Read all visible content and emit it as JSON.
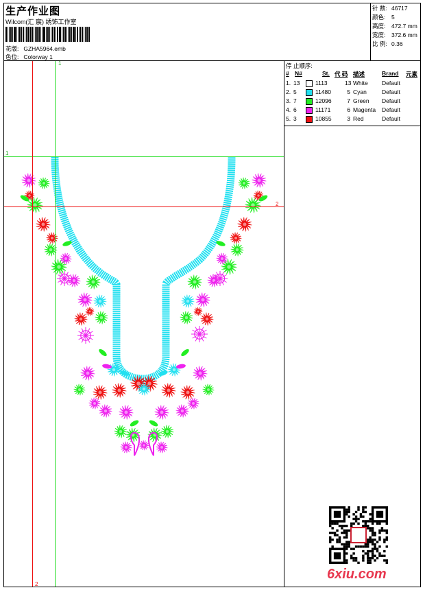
{
  "header": {
    "title": "生产作业图",
    "studio": "Wilcom(汇 宸) 绣饰工作室",
    "design_label": "花版:",
    "design_file": "GZHA5964.emb",
    "color_label": "色位:",
    "colorway": "Colorway 1"
  },
  "stats": [
    {
      "label": "针 数:",
      "value": "46717"
    },
    {
      "label": "颜色:",
      "value": "5"
    },
    {
      "label": "高度:",
      "value": "472.7 mm"
    },
    {
      "label": "宽度:",
      "value": "372.6 mm"
    },
    {
      "label": "比 例:",
      "value": "0.36"
    }
  ],
  "stop_sequence": {
    "title": "停 止顺序:",
    "headers": {
      "num": "#",
      "n": "N#",
      "st": "St.",
      "code": "代 码",
      "desc": "描述",
      "brand": "Brand",
      "elem": "元素"
    },
    "rows": [
      {
        "num": "1.",
        "n": "13",
        "color": "#ffffff",
        "st": "1113",
        "code": "13",
        "desc": "White",
        "brand": "Default"
      },
      {
        "num": "2.",
        "n": "5",
        "color": "#22e0f0",
        "st": "11480",
        "code": "5",
        "desc": "Cyan",
        "brand": "Default"
      },
      {
        "num": "3.",
        "n": "7",
        "color": "#22ee22",
        "st": "12096",
        "code": "7",
        "desc": "Green",
        "brand": "Default"
      },
      {
        "num": "4.",
        "n": "6",
        "color": "#ee22ee",
        "st": "11171",
        "code": "6",
        "desc": "Magenta",
        "brand": "Default"
      },
      {
        "num": "5.",
        "n": "3",
        "color": "#ee1111",
        "st": "10855",
        "code": "3",
        "desc": "Red",
        "brand": "Default"
      }
    ]
  },
  "guides": {
    "green_v": "1",
    "green_h": "1",
    "red_h": "2",
    "red_v": "2"
  },
  "colors": {
    "cyan": "#22e0f0",
    "green": "#22ee22",
    "magenta": "#ee22ee",
    "red": "#ee1111",
    "guide_green": "#22dd22",
    "guide_red": "#ee1111"
  },
  "watermark": "6xiu.com"
}
